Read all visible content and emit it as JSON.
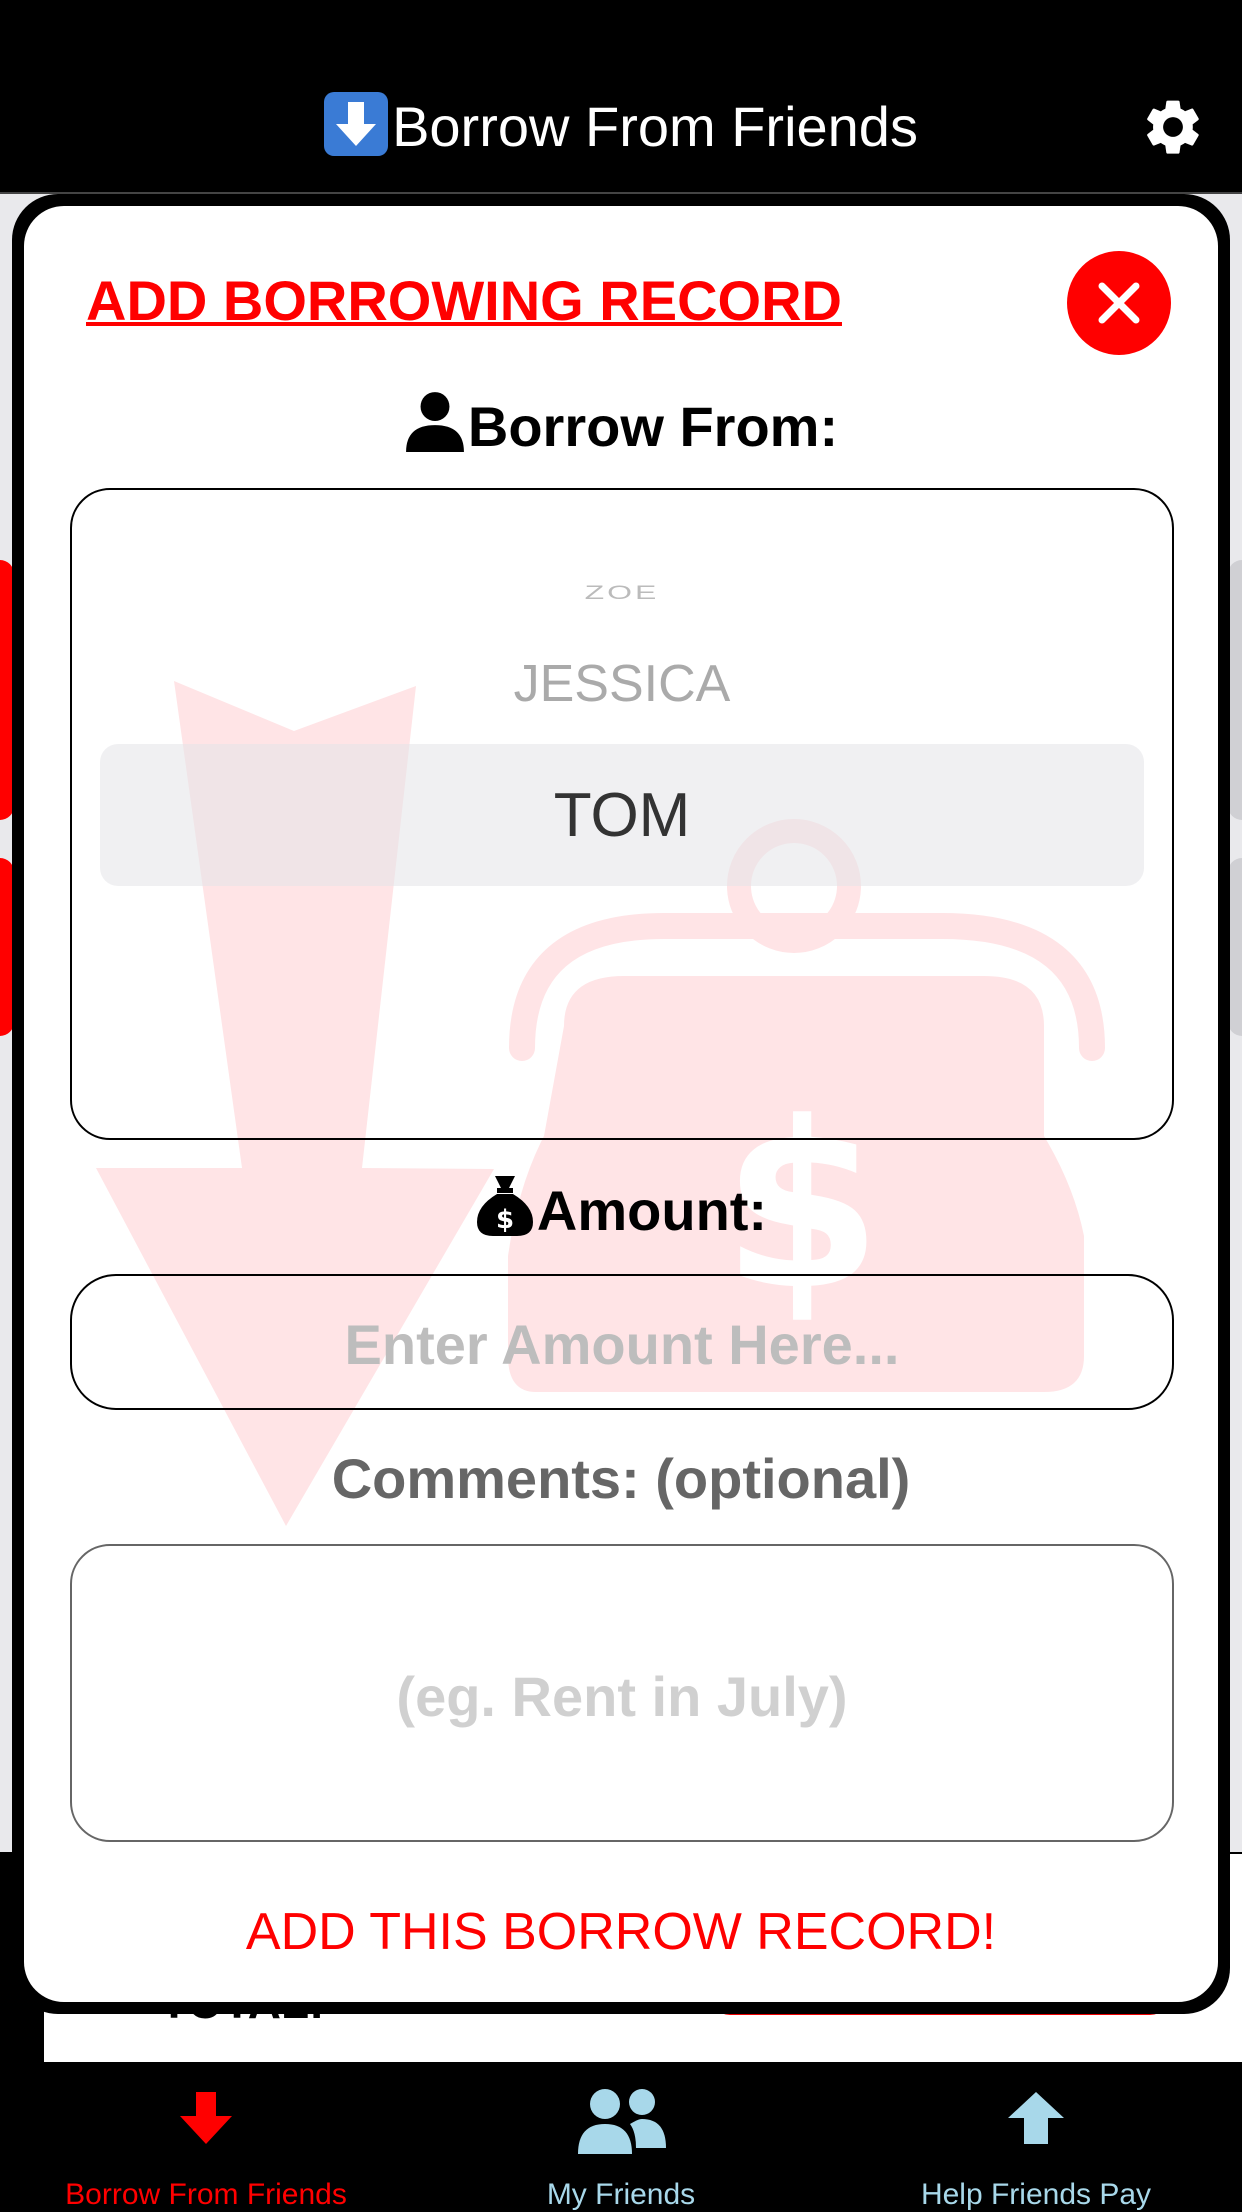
{
  "header": {
    "title": "Borrow From Friends"
  },
  "background": {
    "total_label": "TOTAL:"
  },
  "modal": {
    "title": "ADD BORROWING RECORD",
    "borrow_from_label": "Borrow From:",
    "picker_options": [
      "ZOE",
      "JESSICA",
      "TOM"
    ],
    "picker_selected": "TOM",
    "amount_label": "Amount:",
    "amount_placeholder": "Enter Amount Here...",
    "comments_label": "Comments: (optional)",
    "comments_placeholder": "(eg. Rent in July)",
    "submit_label": "ADD THIS BORROW RECORD!"
  },
  "tabbar": {
    "tabs": [
      {
        "label": "Borrow From Friends",
        "icon": "arrow-down-icon",
        "active": true
      },
      {
        "label": "My Friends",
        "icon": "people-icon",
        "active": false
      },
      {
        "label": "Help Friends Pay",
        "icon": "arrow-up-icon",
        "active": false
      }
    ]
  },
  "colors": {
    "accent": "#ff0000",
    "active_tab": "#ff0000",
    "inactive_tab": "#a8d8ea",
    "header_bg": "#000000"
  }
}
